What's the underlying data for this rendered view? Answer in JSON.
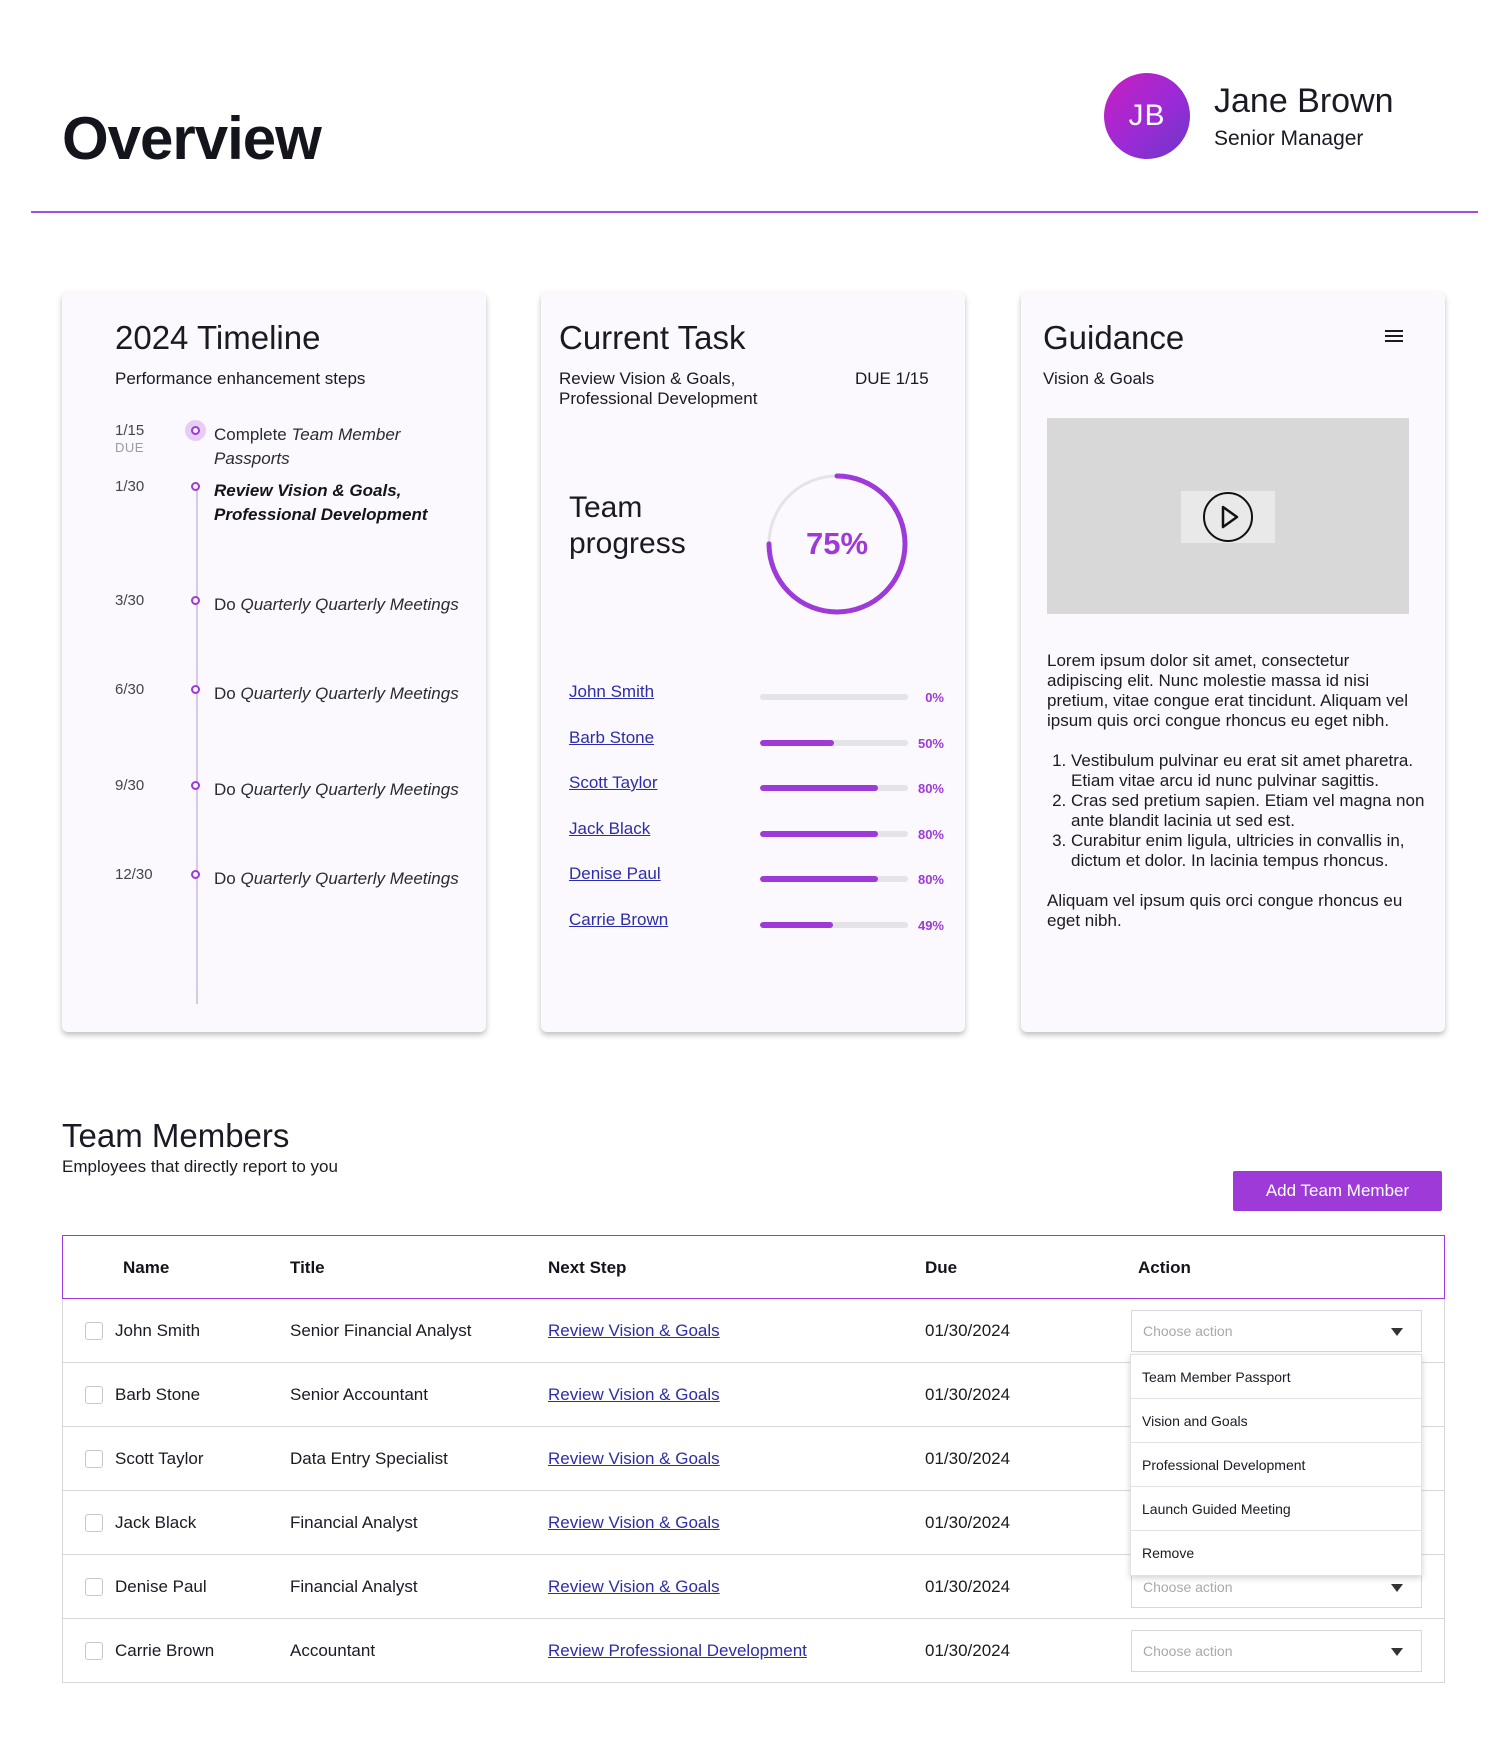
{
  "header": {
    "title": "Overview",
    "user": {
      "initials": "JB",
      "name": "Jane Brown",
      "role": "Senior Manager"
    }
  },
  "timeline": {
    "title": "2024 Timeline",
    "subtitle": "Performance enhancement steps",
    "due_header": "DUE",
    "items": [
      {
        "date": "1/15",
        "text_plain": "Complete ",
        "text_italic": "Team Member Passports",
        "state": "active"
      },
      {
        "date": "1/30",
        "text_plain": "",
        "text_italic": "Review Vision & Goals, Professional Development",
        "state": "current"
      },
      {
        "date": "3/30",
        "text_plain": "Do ",
        "text_italic": "Quarterly Quarterly Meetings",
        "state": "upcoming"
      },
      {
        "date": "6/30",
        "text_plain": "Do ",
        "text_italic": "Quarterly Quarterly Meetings",
        "state": "upcoming"
      },
      {
        "date": "9/30",
        "text_plain": "Do ",
        "text_italic": "Quarterly Quarterly Meetings",
        "state": "upcoming"
      },
      {
        "date": "12/30",
        "text_plain": "Do ",
        "text_italic": "Quarterly Quarterly Meetings",
        "state": "upcoming"
      }
    ]
  },
  "current_task": {
    "title": "Current Task",
    "description": "Review Vision & Goals, Professional Development",
    "due": "DUE 1/15",
    "team_progress_label": "Team progress",
    "team_progress_value": "75%",
    "team_progress_fraction": 0.75,
    "members": [
      {
        "name": "John Smith",
        "percent": 0,
        "label": "0%"
      },
      {
        "name": "Barb Stone",
        "percent": 50,
        "label": "50%"
      },
      {
        "name": "Scott Taylor",
        "percent": 80,
        "label": "80%"
      },
      {
        "name": "Jack Black",
        "percent": 80,
        "label": "80%"
      },
      {
        "name": "Denise Paul",
        "percent": 80,
        "label": "80%"
      },
      {
        "name": "Carrie Brown",
        "percent": 49,
        "label": "49%"
      }
    ]
  },
  "guidance": {
    "title": "Guidance",
    "subtitle": "Vision & Goals",
    "menu_icon": "hamburger-menu-icon",
    "video_icon": "play-icon",
    "intro": "Lorem ipsum dolor sit amet, consectetur adipiscing elit. Nunc molestie massa id nisi pretium, vitae congue erat tincidunt. Aliquam vel ipsum quis orci congue rhoncus eu eget nibh.",
    "list": [
      "Vestibulum pulvinar eu erat sit amet pharetra. Etiam vitae arcu id nunc pulvinar sagittis.",
      "Cras sed pretium sapien. Etiam vel magna non ante blandit lacinia ut sed est.",
      "Curabitur enim ligula, ultricies in convallis in, dictum et dolor. In lacinia tempus rhoncus."
    ],
    "outro": "Aliquam vel ipsum quis orci congue rhoncus eu eget nibh."
  },
  "team": {
    "title": "Team Members",
    "subtitle": "Employees that directly report to you",
    "add_button": "Add Team Member",
    "columns": [
      "Name",
      "Title",
      "Next Step",
      "Due",
      "Action"
    ],
    "select_placeholder": "Choose action",
    "rows": [
      {
        "name": "John Smith",
        "title": "Senior Financial Analyst",
        "next_step": "Review Vision & Goals",
        "due": "01/30/2024",
        "show_select": true
      },
      {
        "name": "Barb Stone",
        "title": "Senior Accountant",
        "next_step": "Review Vision & Goals",
        "due": "01/30/2024",
        "show_select": false
      },
      {
        "name": "Scott Taylor",
        "title": "Data Entry Specialist",
        "next_step": "Review Vision & Goals",
        "due": "01/30/2024",
        "show_select": false
      },
      {
        "name": "Jack Black",
        "title": "Financial Analyst",
        "next_step": "Review Vision & Goals",
        "due": "01/30/2024",
        "show_select": false
      },
      {
        "name": "Denise Paul",
        "title": "Financial Analyst",
        "next_step": "Review Vision & Goals",
        "due": "01/30/2024",
        "show_select": true
      },
      {
        "name": "Carrie Brown",
        "title": "Accountant",
        "next_step": "Review Professional Development",
        "due": "01/30/2024",
        "show_select": true
      }
    ],
    "dropdown_options": [
      "Team Member Passport",
      "Vision and Goals",
      "Professional Development",
      "Launch Guided Meeting",
      "Remove"
    ]
  },
  "colors": {
    "accent": "#9d3ad8",
    "link": "#2d2da8",
    "card_bg": "#fbf9fd"
  }
}
